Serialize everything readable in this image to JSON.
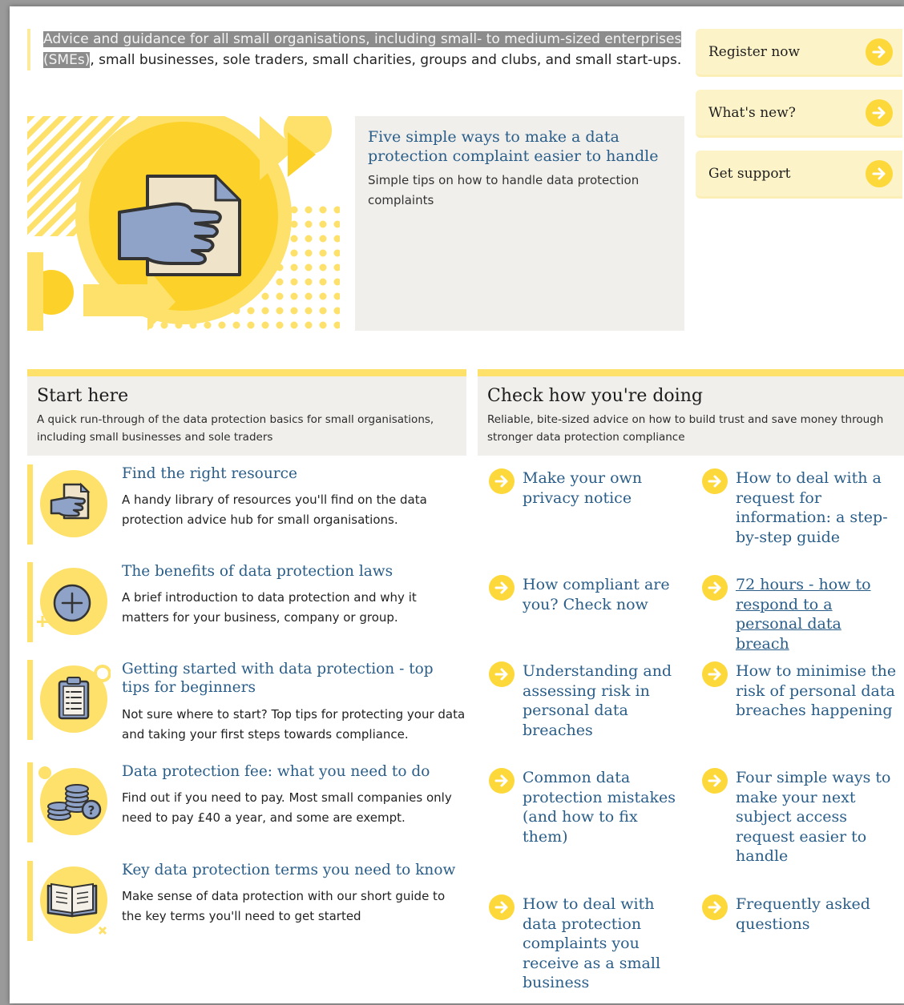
{
  "intro": {
    "highlighted": "Advice and guidance for all small organisations, including small- to medium-sized enterprises (SMEs)",
    "rest": ", small businesses, sole traders, small charities, groups and clubs, and small start-ups."
  },
  "quick_links": [
    {
      "label": "Register now"
    },
    {
      "label": "What's new?"
    },
    {
      "label": "Get support"
    }
  ],
  "feature": {
    "title": "Five simple ways to make a data protection complaint easier to handle",
    "description": "Simple tips on how to handle data protection complaints"
  },
  "start_here": {
    "title": "Start here",
    "description": "A quick run-through of the data protection basics for small organisations, including small businesses and sole traders",
    "items": [
      {
        "title": "Find the right resource",
        "description": "A handy library of resources you'll find on the data protection advice hub for small organisations.",
        "icon": "document-hand-icon"
      },
      {
        "title": "The benefits of data protection laws",
        "description": "A brief introduction to data protection and why it matters for your business, company or group.",
        "icon": "plus-circle-icon"
      },
      {
        "title": "Getting started with data protection - top tips for beginners",
        "description": "Not sure where to start? Top tips for protecting your data and taking your first steps towards compliance.",
        "icon": "clipboard-icon"
      },
      {
        "title": "Data protection fee: what you need to do",
        "description": "Find out if you need to pay. Most small companies only need to pay £40 a year, and some are exempt.",
        "icon": "coins-question-icon"
      },
      {
        "title": "Key data protection terms you need to know",
        "description": "Make sense of data protection with our short guide to the key terms you'll need to get started",
        "icon": "open-book-icon"
      }
    ]
  },
  "check": {
    "title": "Check how you're doing",
    "description": "Reliable, bite-sized advice on how to build trust and save money through stronger data protection compliance",
    "links": [
      {
        "text": "Make your own privacy notice"
      },
      {
        "text": "How to deal with a request for information: a step-by-step guide"
      },
      {
        "text": "How compliant are you? Check now"
      },
      {
        "text": "72 hours - how to respond to a personal data breach"
      },
      {
        "text": "Understanding and assessing risk in personal data breaches"
      },
      {
        "text": "How to minimise the risk of personal data breaches happening"
      },
      {
        "text": "Common data protection mistakes (and how to fix them)"
      },
      {
        "text": "Four simple ways to make your next subject access request easier to handle"
      },
      {
        "text": "How to deal with data protection complaints you receive as a small business"
      },
      {
        "text": "Frequently asked questions"
      }
    ]
  },
  "colors": {
    "accent_yellow": "#fde16a",
    "arrow_yellow": "#fdd83a",
    "link_blue": "#2a5e89",
    "panel_grey": "#f1efec"
  }
}
